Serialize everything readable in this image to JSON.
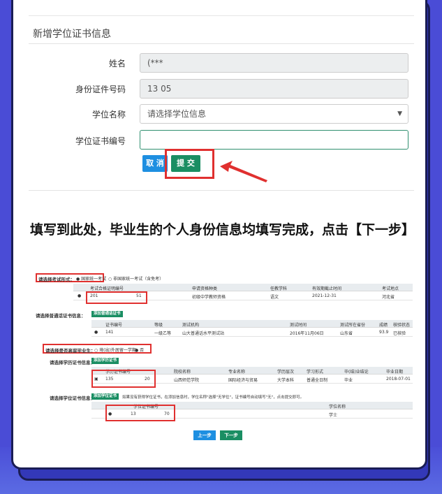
{
  "form": {
    "section_title": "新增学位证书信息",
    "name_label": "姓名",
    "name_value": "(***",
    "id_label": "身份证件号码",
    "id_value": "13                    05",
    "degree_label": "学位名称",
    "degree_placeholder": "请选择学位信息",
    "cert_label": "学位证书编号",
    "cert_value": "",
    "cancel_button": "取 消",
    "submit_button": "提 交"
  },
  "caption": "填写到此处，毕业生的个人身份信息均填写完成，点击【下一步】",
  "mini": {
    "exam_form_label": "请选择考试形式：",
    "exam_opt1": "● 国家统一考试",
    "exam_opt2": "○ 非国家统一考试（含免考）",
    "exam_headers": [
      "考试合格证明编号",
      "申请资格种类",
      "任教学科",
      "有效期截止时间",
      "考试地点"
    ],
    "exam_row": [
      "201",
      "初级中学教师资格",
      "语文",
      "2021-12-31",
      "河北省"
    ],
    "exam_row_suffix": "51",
    "mandarin_label": "请选择普通话证书信息：",
    "mandarin_tag": "添加普通话证书",
    "mandarin_headers": [
      "证书编号",
      "等级",
      "测试机构",
      "测试时间",
      "测试所在省份",
      "成绩",
      "核验状态"
    ],
    "mandarin_row": [
      "141",
      "一级乙等",
      "山大普通话水平测试站",
      "2016年11月06日",
      "山东省",
      "93.9",
      "已核验"
    ],
    "overseas_label": "请选择是否高留毕业生：",
    "overseas_opt1": "○ 境(出)外居留一学期",
    "overseas_opt2": "● 否",
    "edu_label": "请选择学历证书信息：",
    "edu_tag": "添加学历证书",
    "edu_headers": [
      "学历证书编号",
      "院校名称",
      "专业名称",
      "学历层次",
      "学习形式",
      "毕(结)业结论",
      "毕业日期"
    ],
    "edu_row": [
      "135",
      "山西师范学院",
      "国际经济与贸易",
      "大学本科",
      "普通全日制",
      "毕业",
      "2018-07-01"
    ],
    "edu_row_suffix": "20",
    "degree_label": "请选择学位证书信息：",
    "degree_tag": "添加学位证书",
    "degree_note": "如果没有获得学位证书，在添加信息时，学位名称\"选择\"无学位\"，证书编号自动填写\"无\"，点击提交即可。",
    "degree_headers": [
      "学位证书编号",
      "学位名称"
    ],
    "degree_row": [
      "13",
      "学士"
    ],
    "degree_row_suffix": "70",
    "prev_button": "上一步",
    "next_button": "下一步"
  }
}
